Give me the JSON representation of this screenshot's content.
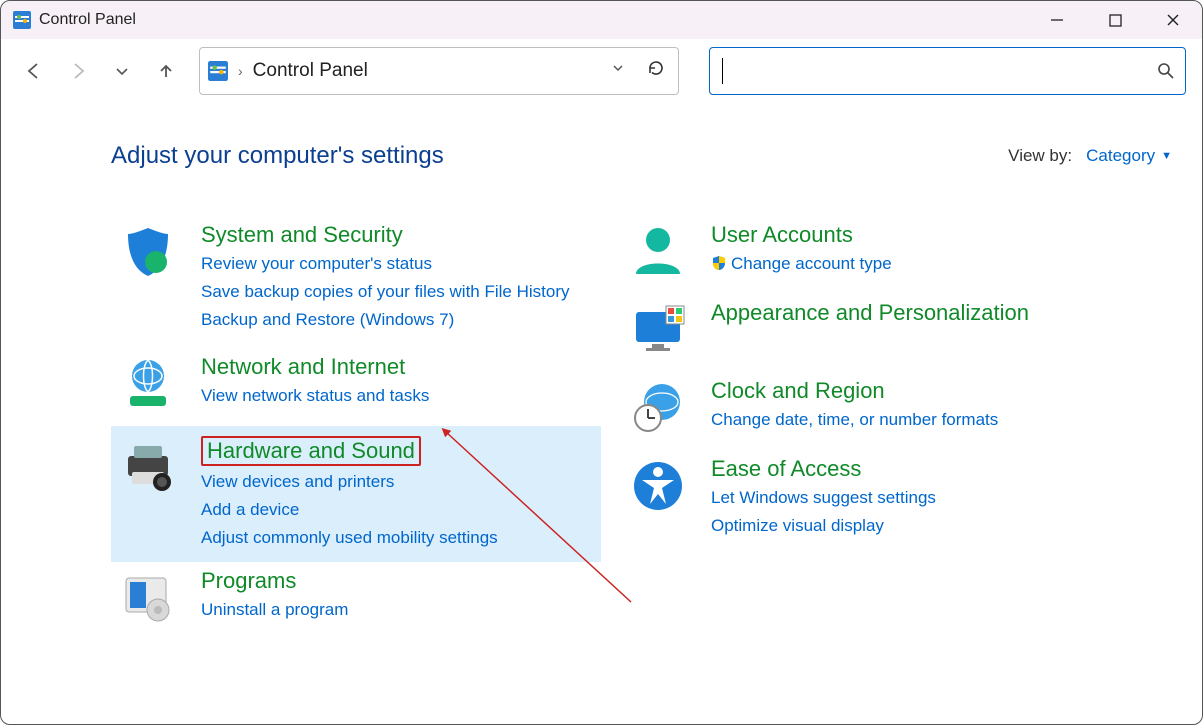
{
  "window": {
    "title": "Control Panel"
  },
  "address": {
    "crumb": "Control Panel"
  },
  "search": {
    "placeholder": ""
  },
  "header": {
    "heading": "Adjust your computer's settings",
    "viewby_label": "View by:",
    "viewby_value": "Category"
  },
  "cats": {
    "system": {
      "title": "System and Security",
      "links": [
        "Review your computer's status",
        "Save backup copies of your files with File History",
        "Backup and Restore (Windows 7)"
      ]
    },
    "network": {
      "title": "Network and Internet",
      "links": [
        "View network status and tasks"
      ]
    },
    "hardware": {
      "title": "Hardware and Sound",
      "links": [
        "View devices and printers",
        "Add a device",
        "Adjust commonly used mobility settings"
      ]
    },
    "programs": {
      "title": "Programs",
      "links": [
        "Uninstall a program"
      ]
    },
    "users": {
      "title": "User Accounts",
      "links": [
        "Change account type"
      ]
    },
    "appearance": {
      "title": "Appearance and Personalization",
      "links": []
    },
    "clock": {
      "title": "Clock and Region",
      "links": [
        "Change date, time, or number formats"
      ]
    },
    "ease": {
      "title": "Ease of Access",
      "links": [
        "Let Windows suggest settings",
        "Optimize visual display"
      ]
    }
  }
}
